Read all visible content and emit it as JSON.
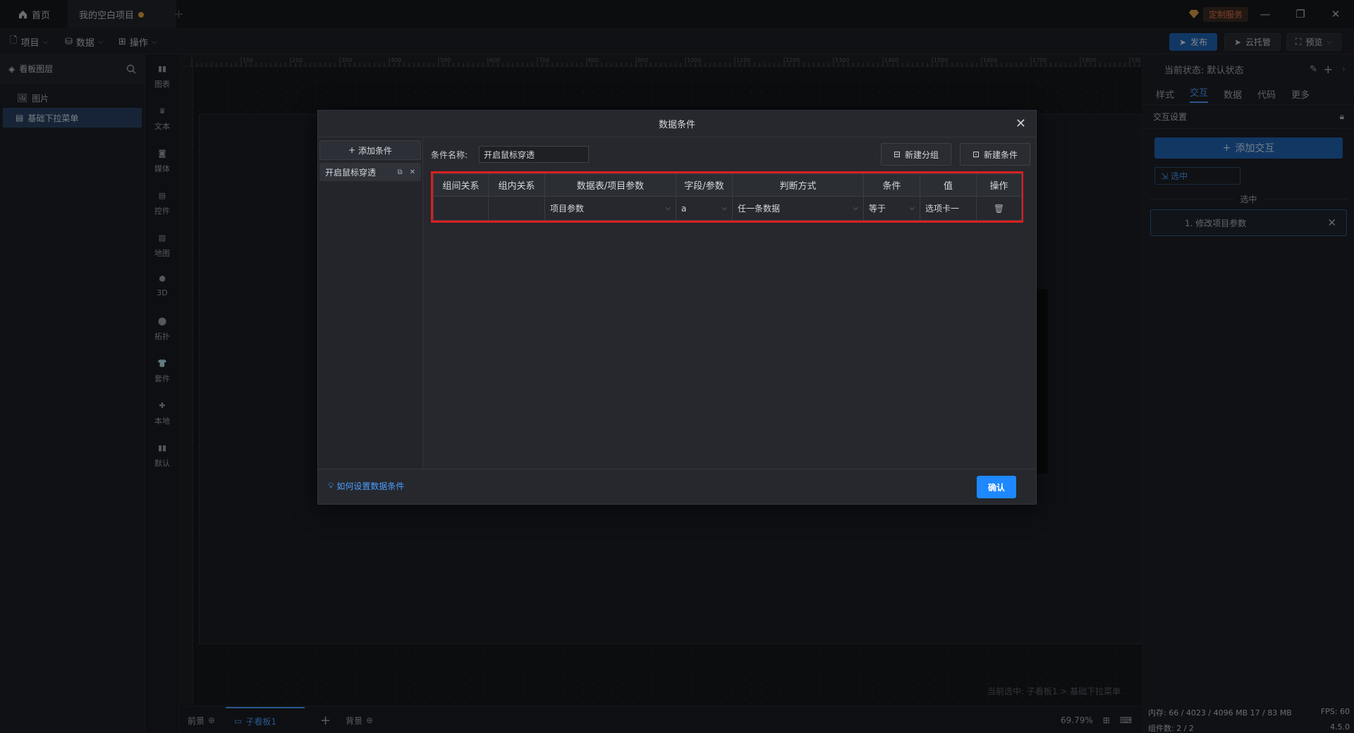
{
  "titlebar": {
    "home_tab": "首页",
    "project_tab": "我的空白项目",
    "custom_service": "定制服务"
  },
  "menubar": {
    "project": "项目",
    "data": "数据",
    "operate": "操作",
    "publish": "发布",
    "cloud_host": "云托管",
    "preview": "预览"
  },
  "layers": {
    "title": "看板图层",
    "items": [
      {
        "label": "图片"
      },
      {
        "label": "基础下拉菜单"
      }
    ]
  },
  "components": [
    "图表",
    "文本",
    "媒体",
    "控件",
    "地图",
    "3D",
    "拓扑",
    "套件",
    "本地",
    "默认"
  ],
  "ruler_labels": [
    "100",
    "200",
    "300",
    "400",
    "500",
    "600",
    "700",
    "800",
    "900",
    "1000",
    "1100",
    "1200",
    "1300",
    "1400",
    "1500",
    "1600",
    "1700",
    "1800",
    "1900"
  ],
  "canvas": {
    "status_selected": "当前选中: 子看板1 > 基础下拉菜单"
  },
  "bottombar": {
    "foreground": "前景",
    "sub_board": "子看板1",
    "background": "背景",
    "zoom": "69.79%"
  },
  "rightpanel": {
    "current_state": "当前状态: 默认状态",
    "tabs": [
      "样式",
      "交互",
      "数据",
      "代码",
      "更多"
    ],
    "active_tab": "交互",
    "section_title": "交互设置",
    "add_interaction": "添加交互",
    "trigger": "选中",
    "divider_label": "选中",
    "action_item": "1. 修改项目参数"
  },
  "sysinfo": {
    "memory": "内存: 66 / 4023 / 4096 MB  17 / 83 MB",
    "fps": "FPS: 60",
    "components": "组件数: 2 / 2",
    "version": "4.5.0"
  },
  "modal": {
    "title": "数据条件",
    "add_condition": "添加条件",
    "condition_item": "开启鼠标穿透",
    "name_label": "条件名称:",
    "name_value": "开启鼠标穿透",
    "new_group": "新建分组",
    "new_condition": "新建条件",
    "table": {
      "headers": [
        "组间关系",
        "组内关系",
        "数据表/项目参数",
        "字段/参数",
        "判断方式",
        "条件",
        "值",
        "操作"
      ],
      "row": {
        "source": "项目参数",
        "field": "a",
        "method": "任一条数据",
        "condition": "等于",
        "value": "选项卡一"
      }
    },
    "help": "如何设置数据条件",
    "confirm": "确认"
  },
  "colors": {
    "accent": "#1e88ff",
    "highlight_border": "#d91f1f",
    "panel_bg": "#1e2025"
  }
}
